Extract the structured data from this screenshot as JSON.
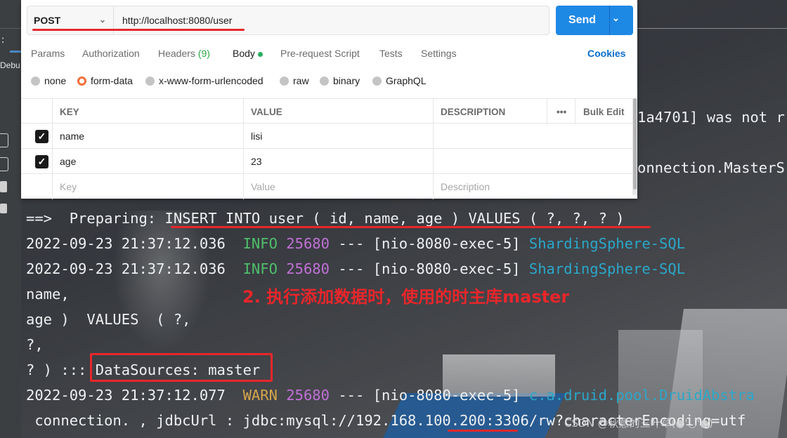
{
  "postman": {
    "method": "POST",
    "url": "http://localhost:8080/user",
    "send_label": "Send",
    "tabs": [
      {
        "label": "Params"
      },
      {
        "label": "Authorization"
      },
      {
        "label": "Headers",
        "count": "(9)"
      },
      {
        "label": "Body"
      },
      {
        "label": "Pre-request Script"
      },
      {
        "label": "Tests"
      },
      {
        "label": "Settings"
      }
    ],
    "cookies_label": "Cookies",
    "body_types": [
      "none",
      "form-data",
      "x-www-form-urlencoded",
      "raw",
      "binary",
      "GraphQL"
    ],
    "selected_body_type": "form-data",
    "table": {
      "headers": {
        "key": "KEY",
        "value": "VALUE",
        "description": "DESCRIPTION",
        "more": "•••",
        "bulk_edit": "Bulk Edit"
      },
      "rows": [
        {
          "checked": true,
          "key": "name",
          "value": "lisi",
          "description": ""
        },
        {
          "checked": true,
          "key": "age",
          "value": "23",
          "description": ""
        }
      ],
      "placeholders": {
        "key": "Key",
        "value": "Value",
        "description": "Description"
      }
    }
  },
  "ide": {
    "debug_label": "Debu",
    "colon": ":"
  },
  "console": {
    "right_fragments": {
      "line1": "1a4701] was not r",
      "line2": "onnection.MasterS"
    },
    "lines": {
      "preparing_prefix": "==>  Preparing: ",
      "preparing_sql": "INSERT INTO user ( id, name, age ) VALUES ( ?, ?, ? )",
      "log1": {
        "ts": "2022-09-23 21:37:12.036",
        "level": "INFO",
        "pid": "25680",
        "thread": "--- [nio-8080-exec-5]",
        "logger": "ShardingSphere-SQL"
      },
      "log2": {
        "ts": "2022-09-23 21:37:12.036",
        "level": "INFO",
        "pid": "25680",
        "thread": "--- [nio-8080-exec-5]",
        "logger": "ShardingSphere-SQL"
      },
      "name_line": "name,",
      "values_line": "age )  VALUES  ( ?,",
      "q_line": "?,",
      "ds_prefix": "? ) ::: ",
      "ds_text": "DataSources: master",
      "log3": {
        "ts": "2022-09-23 21:37:12.077",
        "level": "WARN",
        "pid": "25680",
        "thread": "--- [nio-8080-exec-5]",
        "logger": "c.a.druid.pool.DruidAbstra"
      },
      "jdbc_line": " connection. , jdbcUrl : jdbc:mysql://192.168.100.200:3306/rw?characterEncoding=utf"
    },
    "annotation": "2. 执行添加数据时，使用的时主库master",
    "watermark": "CSDN @秋意的三叶草(●'◡'●)"
  }
}
